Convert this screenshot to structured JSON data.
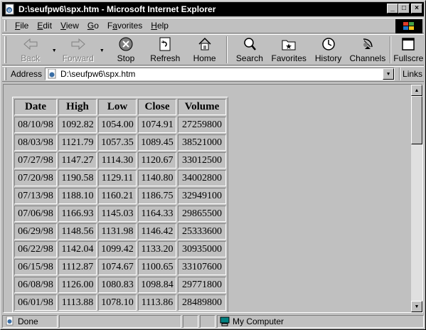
{
  "window": {
    "title": "D:\\seufpw6\\spx.htm - Microsoft Internet Explorer",
    "minimize_glyph": "_",
    "maximize_glyph": "□",
    "close_glyph": "×"
  },
  "menu": {
    "items": [
      {
        "accel": "F",
        "rest": "ile"
      },
      {
        "accel": "E",
        "rest": "dit"
      },
      {
        "accel": "V",
        "rest": "iew"
      },
      {
        "accel": "G",
        "rest": "o"
      },
      {
        "accel": "",
        "pre": "F",
        "mid": "a",
        "rest": "vorites"
      },
      {
        "accel": "H",
        "rest": "elp"
      }
    ]
  },
  "toolbar": {
    "back": "Back",
    "forward": "Forward",
    "stop": "Stop",
    "refresh": "Refresh",
    "home": "Home",
    "search": "Search",
    "favorites": "Favorites",
    "history": "History",
    "channels": "Channels",
    "fullscreen": "Fullscre"
  },
  "address": {
    "label": "Address",
    "value": "D:\\seufpw6\\spx.htm",
    "links": "Links"
  },
  "table": {
    "headers": [
      "Date",
      "High",
      "Low",
      "Close",
      "Volume"
    ],
    "rows": [
      [
        "08/10/98",
        "1092.82",
        "1054.00",
        "1074.91",
        "27259800"
      ],
      [
        "08/03/98",
        "1121.79",
        "1057.35",
        "1089.45",
        "38521000"
      ],
      [
        "07/27/98",
        "1147.27",
        "1114.30",
        "1120.67",
        "33012500"
      ],
      [
        "07/20/98",
        "1190.58",
        "1129.11",
        "1140.80",
        "34002800"
      ],
      [
        "07/13/98",
        "1188.10",
        "1160.21",
        "1186.75",
        "32949100"
      ],
      [
        "07/06/98",
        "1166.93",
        "1145.03",
        "1164.33",
        "29865500"
      ],
      [
        "06/29/98",
        "1148.56",
        "1131.98",
        "1146.42",
        "25333600"
      ],
      [
        "06/22/98",
        "1142.04",
        "1099.42",
        "1133.20",
        "30935000"
      ],
      [
        "06/15/98",
        "1112.87",
        "1074.67",
        "1100.65",
        "33107600"
      ],
      [
        "06/08/98",
        "1126.00",
        "1080.83",
        "1098.84",
        "29771800"
      ],
      [
        "06/01/98",
        "1113.88",
        "1078.10",
        "1113.86",
        "28489800"
      ]
    ]
  },
  "status": {
    "text": "Done",
    "zone": "My Computer"
  }
}
